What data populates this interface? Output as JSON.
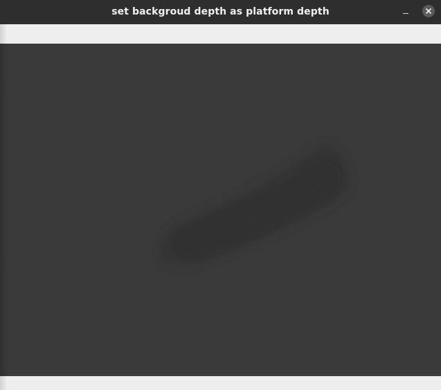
{
  "window": {
    "title": "set backgroud depth as platform depth"
  },
  "titlebar": {
    "minimize_icon": "minimize-icon",
    "close_icon": "close-icon"
  },
  "viewport": {
    "background_color": "#3a3a3a",
    "blob_color": "#353535"
  },
  "panels": {
    "color": "#eeeeee"
  }
}
